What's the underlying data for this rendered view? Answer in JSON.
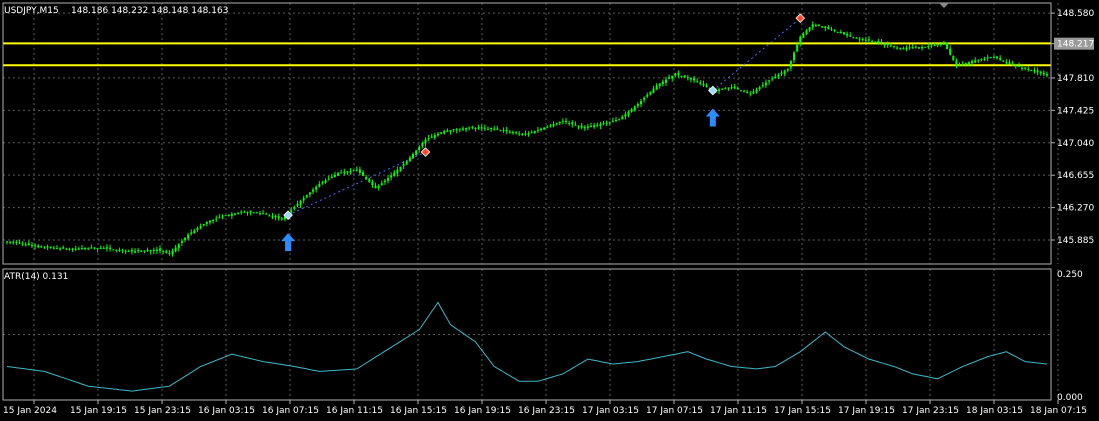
{
  "header": {
    "symbol": "USDJPY,M15",
    "ohlc": "148.186 148.232 148.148 148.163"
  },
  "indicator": {
    "label": "ATR(14) 0.131"
  },
  "colors": {
    "background": "#000000",
    "grid": "#5a5a5a",
    "candle": "#00ff00",
    "hline": "#ffff00",
    "current_price_badge": "#9a9a9a",
    "atr_line": "#3fb8c8",
    "arrow": "#2a8cff",
    "buy_marker": "#a0d8ff",
    "sell_marker": "#ff4a2a"
  },
  "chart_data": [
    {
      "type": "candlestick",
      "title": "USDJPY,M15",
      "ylim": [
        145.6,
        148.7
      ],
      "y_ticks": [
        "148.580",
        "148.217",
        "147.810",
        "147.425",
        "147.040",
        "146.655",
        "146.270",
        "145.885"
      ],
      "current_price": "148.217",
      "horizontal_lines": [
        148.22,
        147.96
      ],
      "x_ticks": [
        "15 Jan 2024",
        "15 Jan 19:15",
        "15 Jan 23:15",
        "16 Jan 03:15",
        "16 Jan 07:15",
        "16 Jan 11:15",
        "16 Jan 15:15",
        "16 Jan 19:15",
        "16 Jan 23:15",
        "17 Jan 03:15",
        "17 Jan 07:15",
        "17 Jan 11:15",
        "17 Jan 15:15",
        "17 Jan 19:15",
        "17 Jan 23:15",
        "18 Jan 03:15",
        "18 Jan 07:15"
      ],
      "close_path": [
        {
          "i": 0,
          "v": 145.87
        },
        {
          "i": 5,
          "v": 145.84
        },
        {
          "i": 10,
          "v": 145.8
        },
        {
          "i": 20,
          "v": 145.78
        },
        {
          "i": 30,
          "v": 145.79
        },
        {
          "i": 40,
          "v": 145.75
        },
        {
          "i": 48,
          "v": 145.77
        },
        {
          "i": 52,
          "v": 145.72
        },
        {
          "i": 58,
          "v": 145.95
        },
        {
          "i": 64,
          "v": 146.1
        },
        {
          "i": 70,
          "v": 146.18
        },
        {
          "i": 76,
          "v": 146.22
        },
        {
          "i": 82,
          "v": 146.2
        },
        {
          "i": 88,
          "v": 146.13
        },
        {
          "i": 94,
          "v": 146.35
        },
        {
          "i": 100,
          "v": 146.55
        },
        {
          "i": 106,
          "v": 146.68
        },
        {
          "i": 112,
          "v": 146.72
        },
        {
          "i": 118,
          "v": 146.5
        },
        {
          "i": 122,
          "v": 146.62
        },
        {
          "i": 128,
          "v": 146.82
        },
        {
          "i": 134,
          "v": 147.08
        },
        {
          "i": 140,
          "v": 147.18
        },
        {
          "i": 148,
          "v": 147.22
        },
        {
          "i": 156,
          "v": 147.2
        },
        {
          "i": 166,
          "v": 147.14
        },
        {
          "i": 172,
          "v": 147.22
        },
        {
          "i": 178,
          "v": 147.3
        },
        {
          "i": 184,
          "v": 147.22
        },
        {
          "i": 190,
          "v": 147.26
        },
        {
          "i": 196,
          "v": 147.32
        },
        {
          "i": 202,
          "v": 147.5
        },
        {
          "i": 208,
          "v": 147.72
        },
        {
          "i": 214,
          "v": 147.86
        },
        {
          "i": 220,
          "v": 147.78
        },
        {
          "i": 226,
          "v": 147.66
        },
        {
          "i": 232,
          "v": 147.7
        },
        {
          "i": 238,
          "v": 147.62
        },
        {
          "i": 244,
          "v": 147.78
        },
        {
          "i": 250,
          "v": 147.92
        },
        {
          "i": 254,
          "v": 148.3
        },
        {
          "i": 258,
          "v": 148.45
        },
        {
          "i": 264,
          "v": 148.38
        },
        {
          "i": 270,
          "v": 148.3
        },
        {
          "i": 278,
          "v": 148.24
        },
        {
          "i": 286,
          "v": 148.16
        },
        {
          "i": 294,
          "v": 148.18
        },
        {
          "i": 300,
          "v": 148.22
        },
        {
          "i": 304,
          "v": 147.95
        },
        {
          "i": 310,
          "v": 148.02
        },
        {
          "i": 316,
          "v": 148.06
        },
        {
          "i": 322,
          "v": 147.96
        },
        {
          "i": 328,
          "v": 147.9
        },
        {
          "i": 333,
          "v": 147.84
        }
      ],
      "signals": [
        {
          "kind": "buy",
          "i": 90,
          "price": 146.18,
          "arrow": true
        },
        {
          "kind": "sell",
          "i": 134,
          "price": 146.93,
          "arrow": false
        },
        {
          "kind": "buy",
          "i": 226,
          "price": 147.66,
          "arrow": true
        },
        {
          "kind": "sell",
          "i": 254,
          "price": 148.52,
          "arrow": false
        }
      ]
    },
    {
      "type": "line",
      "title": "ATR(14) 0.131",
      "ylim": [
        0.0,
        0.25
      ],
      "y_ticks": [
        "0.250",
        "0.000"
      ],
      "series": [
        {
          "values_path": [
            {
              "i": 0,
              "v": 0.06
            },
            {
              "i": 12,
              "v": 0.05
            },
            {
              "i": 26,
              "v": 0.02
            },
            {
              "i": 40,
              "v": 0.01
            },
            {
              "i": 52,
              "v": 0.02
            },
            {
              "i": 62,
              "v": 0.06
            },
            {
              "i": 72,
              "v": 0.085
            },
            {
              "i": 82,
              "v": 0.07
            },
            {
              "i": 92,
              "v": 0.06
            },
            {
              "i": 100,
              "v": 0.05
            },
            {
              "i": 112,
              "v": 0.055
            },
            {
              "i": 122,
              "v": 0.095
            },
            {
              "i": 132,
              "v": 0.135
            },
            {
              "i": 138,
              "v": 0.19
            },
            {
              "i": 142,
              "v": 0.145
            },
            {
              "i": 150,
              "v": 0.11
            },
            {
              "i": 156,
              "v": 0.06
            },
            {
              "i": 164,
              "v": 0.03
            },
            {
              "i": 170,
              "v": 0.03
            },
            {
              "i": 178,
              "v": 0.045
            },
            {
              "i": 186,
              "v": 0.075
            },
            {
              "i": 194,
              "v": 0.065
            },
            {
              "i": 202,
              "v": 0.07
            },
            {
              "i": 210,
              "v": 0.08
            },
            {
              "i": 218,
              "v": 0.09
            },
            {
              "i": 224,
              "v": 0.075
            },
            {
              "i": 232,
              "v": 0.06
            },
            {
              "i": 240,
              "v": 0.055
            },
            {
              "i": 246,
              "v": 0.06
            },
            {
              "i": 254,
              "v": 0.09
            },
            {
              "i": 262,
              "v": 0.13
            },
            {
              "i": 268,
              "v": 0.1
            },
            {
              "i": 276,
              "v": 0.075
            },
            {
              "i": 284,
              "v": 0.06
            },
            {
              "i": 290,
              "v": 0.045
            },
            {
              "i": 298,
              "v": 0.035
            },
            {
              "i": 306,
              "v": 0.06
            },
            {
              "i": 314,
              "v": 0.08
            },
            {
              "i": 320,
              "v": 0.09
            },
            {
              "i": 326,
              "v": 0.07
            },
            {
              "i": 333,
              "v": 0.065
            }
          ]
        }
      ]
    }
  ]
}
